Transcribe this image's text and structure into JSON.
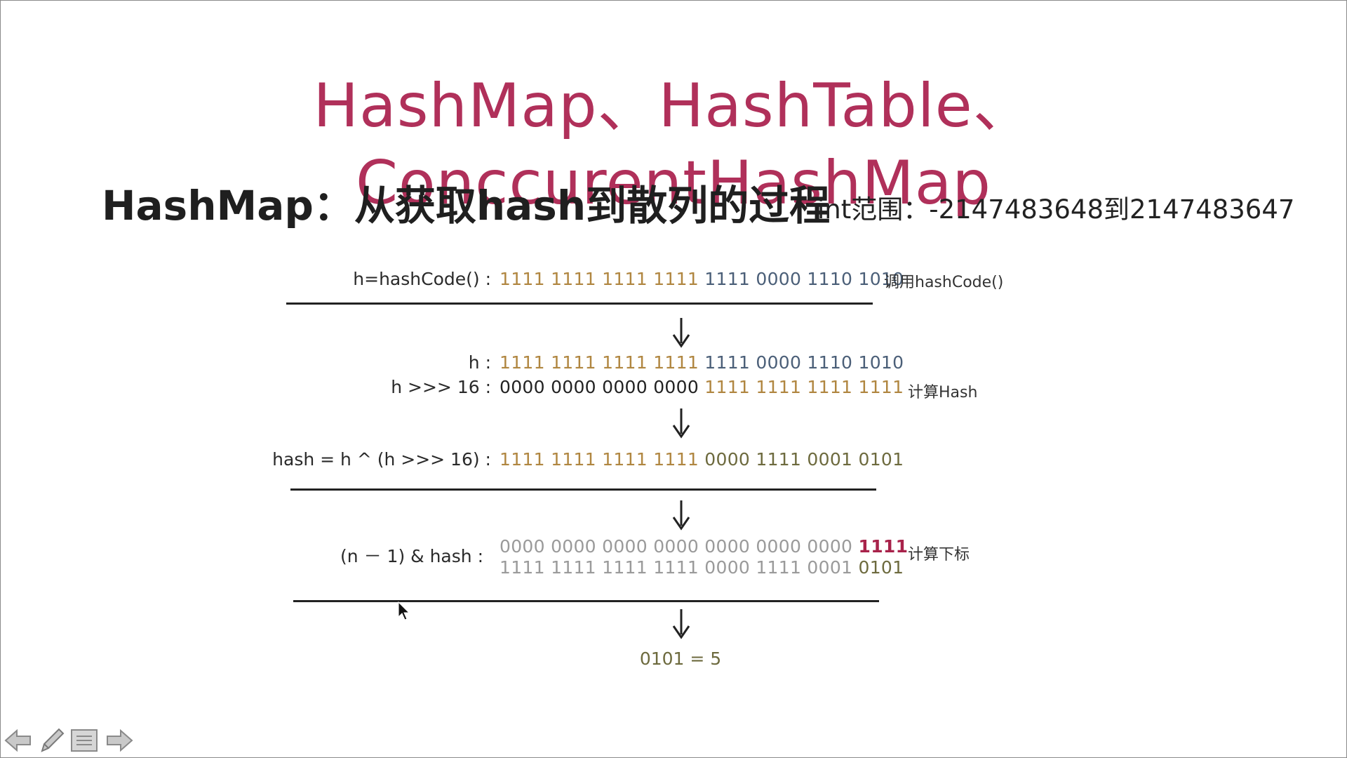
{
  "slide": {
    "title": "HashMap、HashTable、ConccurentHashMap",
    "subtitle": "HashMap：从获取hash到散列的过程",
    "range_note": "int范围：-2147483648到2147483647"
  },
  "steps": {
    "hashcode": {
      "label": "h=hashCode() :",
      "bits_gold": "1111 1111 1111 1111",
      "bits_blue": "1111 0000 1110 1010",
      "note": "调用hashCode()"
    },
    "h": {
      "label": "h :",
      "bits_gold": "1111 1111 1111 1111",
      "bits_blue": "1111 0000 1110 1010"
    },
    "shift": {
      "label": "h >>> 16 :",
      "bits_black": "0000 0000 0000 0000",
      "bits_gold": "1111 1111 1111 1111",
      "note": "计算Hash"
    },
    "hash": {
      "label": "hash = h ^ (h >>> 16) :",
      "bits_gold": "1111 1111 1111 1111",
      "bits_olive": "0000 1111 0001 0101"
    },
    "index": {
      "label": "(n － 1) & hash :",
      "mask_gray": "0000 0000 0000 0000 0000 0000 0000",
      "mask_red": "1111",
      "hash_gray": "1111 1111 1111 1111 0000 1111 0001",
      "hash_olive": "0101",
      "note": "计算下标"
    },
    "result": "0101 = 5"
  },
  "nav": {
    "icons": [
      "arrow-left-icon",
      "pen-icon",
      "menu-icon",
      "arrow-right-icon"
    ]
  },
  "colors": {
    "title": "#b0305a",
    "gold_bits": "#b08640",
    "blue_bits": "#4b5f78",
    "red_bits": "#a8224a",
    "olive_bits": "#6d6a3e"
  }
}
